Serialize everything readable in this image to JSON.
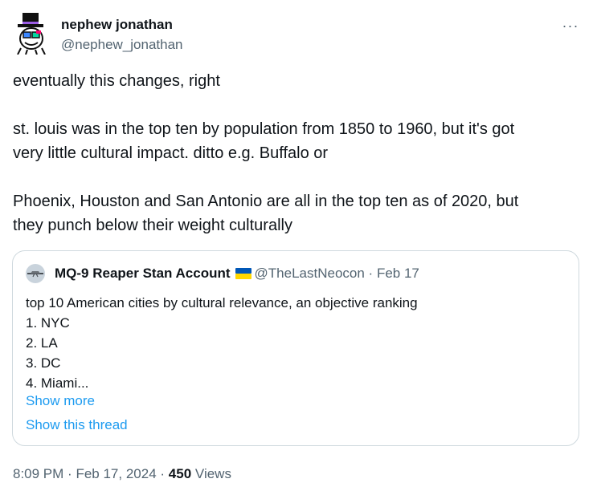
{
  "author": {
    "name": "nephew jonathan",
    "handle": "@nephew_jonathan",
    "avatar_icon": "top-hat-cartoon-avatar-icon"
  },
  "more_icon": "more-horizontal-icon",
  "more_label": "···",
  "tweet": {
    "lines": [
      "eventually this changes, right",
      "",
      "st. louis was in the top ten by population from 1850 to 1960, but it's got",
      "very little cultural impact. ditto e.g. Buffalo or",
      "",
      "Phoenix, Houston and San Antonio are all in the top ten as of 2020, but",
      "they punch below their weight culturally"
    ]
  },
  "quote": {
    "name": "MQ-9 Reaper Stan Account",
    "flag_icon": "ukraine-flag-icon",
    "handle": "@TheLastNeocon",
    "separator": "·",
    "date": "Feb 17",
    "avatar_icon": "drone-avatar-icon",
    "lines": [
      "top 10 American cities by cultural relevance, an objective ranking",
      "1. NYC",
      "2. LA",
      "3. DC",
      "4. Miami..."
    ],
    "show_more": "Show more",
    "show_thread": "Show this thread"
  },
  "meta": {
    "time": "8:09 PM",
    "separator": "·",
    "date": "Feb 17, 2024",
    "views_count": "450",
    "views_label": "Views"
  },
  "colors": {
    "text": "#0f1419",
    "secondary": "#536471",
    "link": "#1d9bf0",
    "border": "#cfd9de",
    "flag_blue": "#0057b7",
    "flag_yellow": "#ffd700"
  }
}
